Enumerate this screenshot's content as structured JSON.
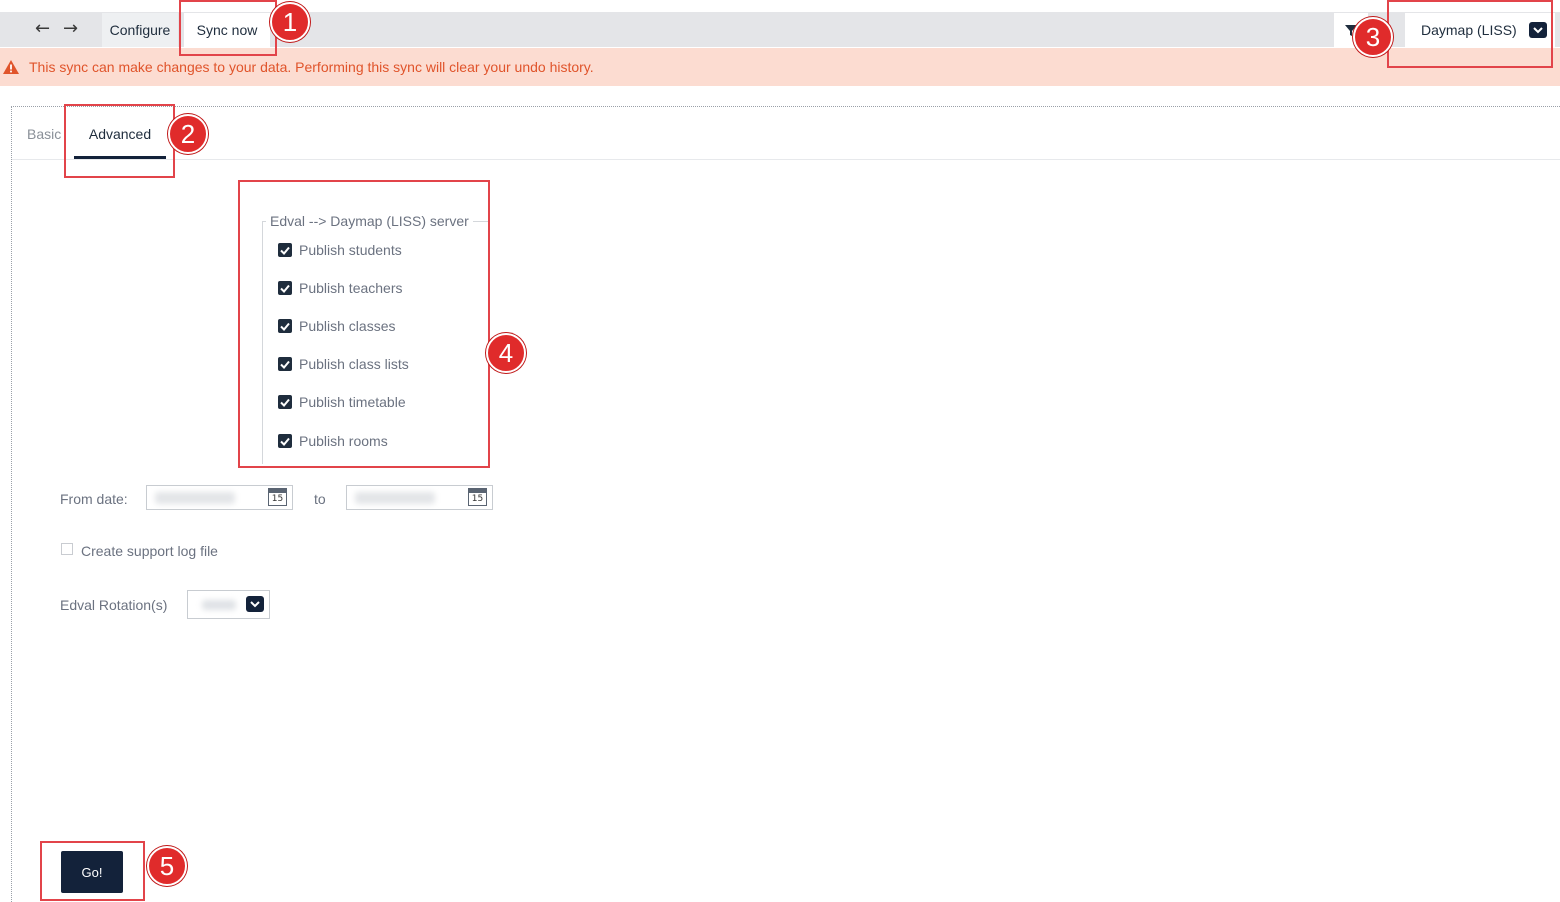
{
  "toolbar": {
    "configure_label": "Configure",
    "sync_now_label": "Sync now",
    "system_selected": "Daymap (LISS)"
  },
  "warning": {
    "text": "This sync can make changes to your data. Performing this sync will clear your undo history."
  },
  "tabs": {
    "basic": "Basic",
    "advanced": "Advanced"
  },
  "publish": {
    "legend": "Edval --> Daymap (LISS) server",
    "items": [
      {
        "label": "Publish students",
        "checked": true
      },
      {
        "label": "Publish teachers",
        "checked": true
      },
      {
        "label": "Publish classes",
        "checked": true
      },
      {
        "label": "Publish class lists",
        "checked": true
      },
      {
        "label": "Publish timetable",
        "checked": true
      },
      {
        "label": "Publish rooms",
        "checked": true
      }
    ]
  },
  "form": {
    "from_date_label": "From date:",
    "to_label": "to",
    "calendar_day": "15",
    "support_log_label": "Create support log file",
    "support_log_checked": false,
    "rotation_label": "Edval Rotation(s)"
  },
  "go_label": "Go!",
  "callouts": [
    "1",
    "2",
    "3",
    "4",
    "5"
  ],
  "colors": {
    "primary": "#13223a",
    "warning_bg": "#fcdcd1",
    "warning_text": "#e0542b",
    "callout": "#e02b2b"
  }
}
